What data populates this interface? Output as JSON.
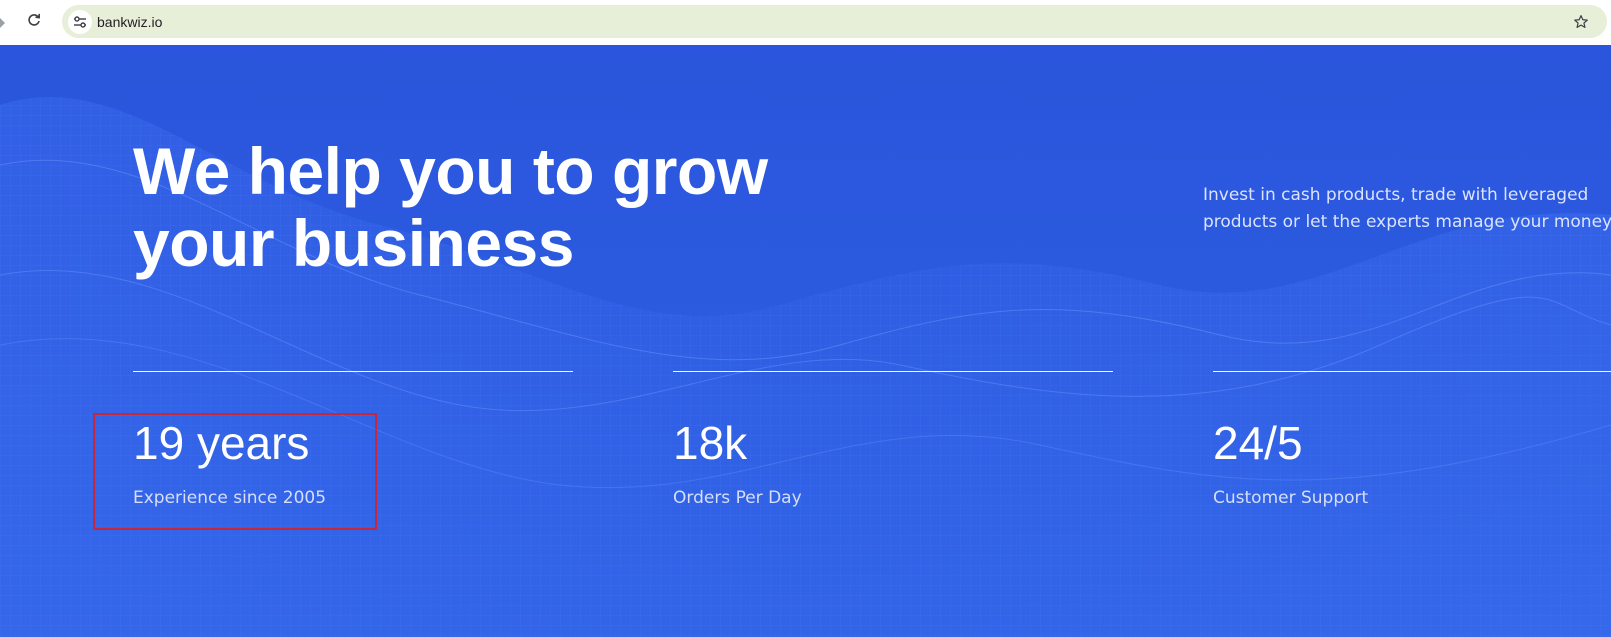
{
  "browser": {
    "url": "bankwiz.io"
  },
  "hero": {
    "headline_regular": "We help you to ",
    "headline_bold_1": "grow",
    "headline_bold_2": "your business",
    "tagline_line1": "Invest in cash products, trade with leveraged",
    "tagline_line2": "products or let the experts manage your money."
  },
  "stats": [
    {
      "value": "19 years",
      "label": "Experience since 2005"
    },
    {
      "value": "18k",
      "label": "Orders Per Day"
    },
    {
      "value": "24/5",
      "label": "Customer Support"
    }
  ],
  "colors": {
    "hero_bg": "#2b59dc",
    "omnibox_bg": "#e8efd9",
    "highlight": "#c8263c"
  },
  "icons": {
    "forward": "chevron-right-icon",
    "reload": "reload-icon",
    "site_info": "tune-icon",
    "bookmark": "star-icon"
  }
}
